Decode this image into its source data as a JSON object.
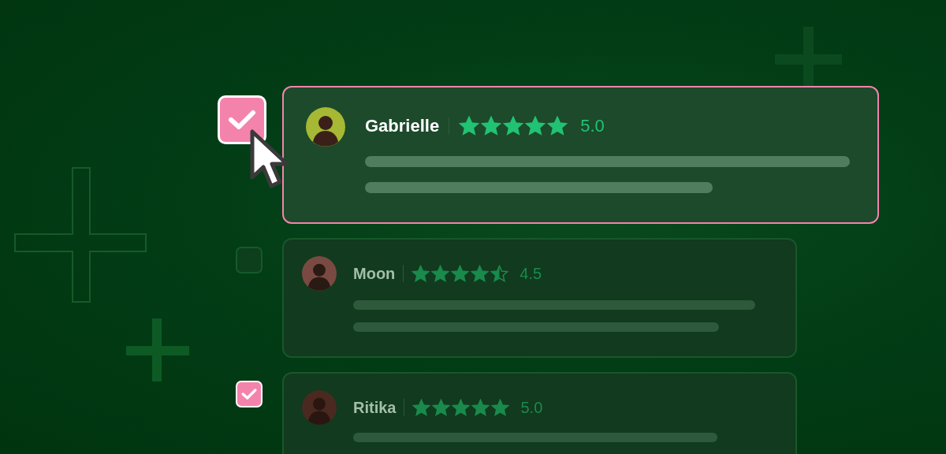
{
  "reviews": [
    {
      "name": "Gabrielle",
      "stars": 5,
      "rating": "5.0",
      "checked": true,
      "selected": true
    },
    {
      "name": "Moon",
      "stars": 4.5,
      "rating": "4.5",
      "checked": false,
      "selected": false
    },
    {
      "name": "Ritika",
      "stars": 5,
      "rating": "5.0",
      "checked": true,
      "selected": false
    }
  ]
}
